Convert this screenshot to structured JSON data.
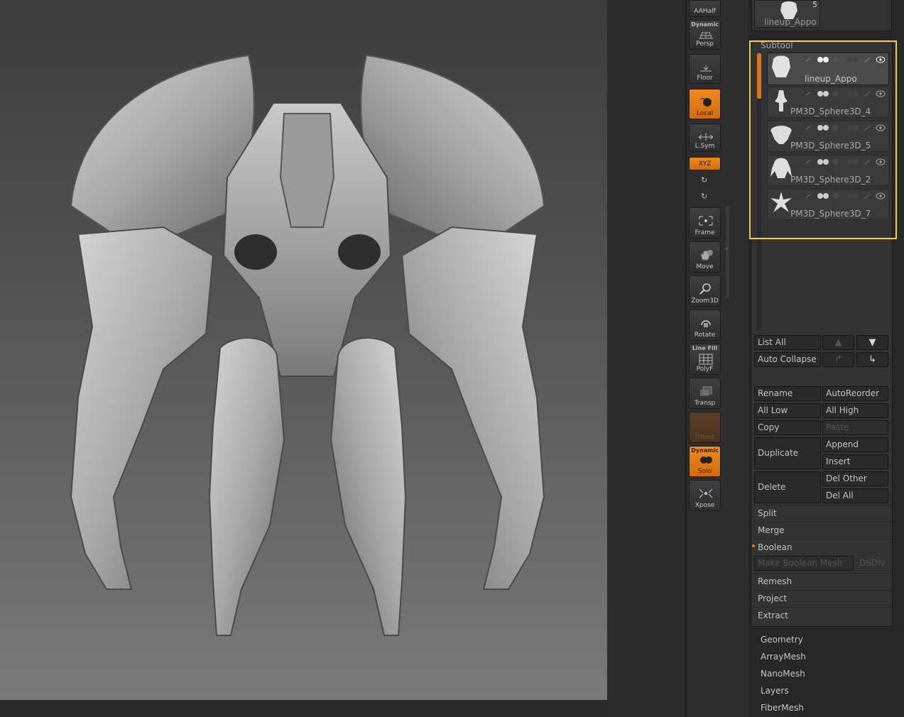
{
  "shelf": {
    "aahalf": "AAHalf",
    "persp_top": "Dynamic",
    "persp": "Persp",
    "floor": "Floor",
    "local": "Local",
    "lsym": "L.Sym",
    "xyz": "XYZ",
    "frame": "Frame",
    "move": "Move",
    "zoom3d": "Zoom3D",
    "rotate": "Rotate",
    "polyf_top": "Line Fill",
    "polyf": "PolyF",
    "transp": "Transp",
    "ghost": "Ghost",
    "solo_top": "Dynamic",
    "solo": "Solo",
    "xpose": "Xpose"
  },
  "tool": {
    "thumb_name": "lineup_Appo",
    "thumb_count": "5"
  },
  "subtool": {
    "title": "Subtool",
    "items": [
      {
        "name": "lineup_Appo"
      },
      {
        "name": "PM3D_Sphere3D_4"
      },
      {
        "name": "PM3D_Sphere3D_5"
      },
      {
        "name": "PM3D_Sphere3D_2"
      },
      {
        "name": "PM3D_Sphere3D_7"
      }
    ]
  },
  "buttons": {
    "list_all": "List All",
    "auto_collapse": "Auto Collapse",
    "rename": "Rename",
    "auto_reorder": "AutoReorder",
    "all_low": "All Low",
    "all_high": "All High",
    "copy": "Copy",
    "paste": "Paste",
    "duplicate": "Duplicate",
    "append": "Append",
    "insert": "Insert",
    "delete": "Delete",
    "del_other": "Del Other",
    "del_all": "Del All"
  },
  "sections": {
    "split": "Split",
    "merge": "Merge",
    "boolean": "Boolean",
    "make_boolean_mesh": "Make Boolean Mesh",
    "dsdiv": "DSDiv",
    "remesh": "Remesh",
    "project": "Project",
    "extract": "Extract"
  },
  "subpalettes": [
    "Geometry",
    "ArrayMesh",
    "NanoMesh",
    "Layers",
    "FiberMesh"
  ],
  "colors": {
    "accent": "#e8801a",
    "highlight": "#f3d22b"
  }
}
